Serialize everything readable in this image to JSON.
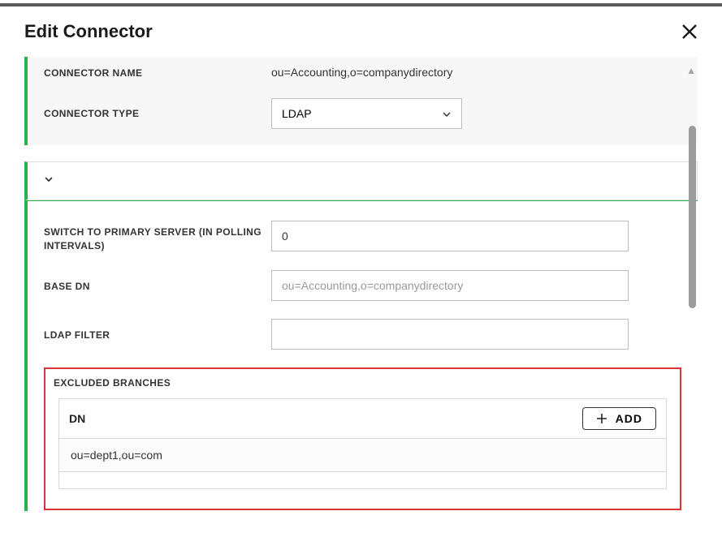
{
  "dialog": {
    "title": "Edit Connector"
  },
  "form": {
    "connector_name_label": "CONNECTOR NAME",
    "connector_name_value": "ou=Accounting,o=companydirectory",
    "connector_type_label": "CONNECTOR TYPE",
    "connector_type_value": "LDAP",
    "switch_primary_label": "SWITCH TO PRIMARY SERVER (IN POLLING INTERVALS)",
    "switch_primary_value": "0",
    "base_dn_label": "BASE DN",
    "base_dn_placeholder": "ou=Accounting,o=companydirectory",
    "base_dn_value": "",
    "ldap_filter_label": "LDAP FILTER",
    "ldap_filter_value": ""
  },
  "excluded": {
    "section_label": "EXCLUDED BRANCHES",
    "column_header": "DN",
    "add_button": "ADD",
    "rows": [
      {
        "dn": "ou=dept1,ou=com"
      }
    ]
  }
}
